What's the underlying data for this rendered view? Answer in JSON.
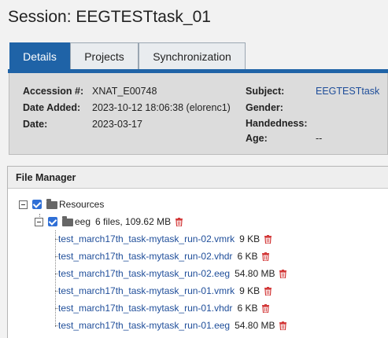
{
  "page": {
    "title": "Session: EEGTESTtask_01"
  },
  "tabs": [
    {
      "label": "Details"
    },
    {
      "label": "Projects"
    },
    {
      "label": "Synchronization"
    }
  ],
  "details": {
    "accession_label": "Accession #:",
    "accession_value": "XNAT_E00748",
    "date_added_label": "Date Added:",
    "date_added_value": "2023-10-12 18:06:38 (elorenc1)",
    "date_label": "Date:",
    "date_value": "2023-03-17",
    "subject_label": "Subject:",
    "subject_value": "EEGTESTtask",
    "gender_label": "Gender:",
    "handedness_label": "Handedness:",
    "age_label": "Age:",
    "age_value": "--"
  },
  "file_manager": {
    "title": "File Manager",
    "root": {
      "label": "Resources"
    },
    "folder": {
      "label": "eeg",
      "summary": "6 files, 109.62 MB"
    },
    "files": [
      {
        "name": "test_march17th_task-mytask_run-02.vmrk",
        "size": "9 KB"
      },
      {
        "name": "test_march17th_task-mytask_run-02.vhdr",
        "size": "6 KB"
      },
      {
        "name": "test_march17th_task-mytask_run-02.eeg",
        "size": "54.80 MB"
      },
      {
        "name": "test_march17th_task-mytask_run-01.vmrk",
        "size": "9 KB"
      },
      {
        "name": "test_march17th_task-mytask_run-01.vhdr",
        "size": "6 KB"
      },
      {
        "name": "test_march17th_task-mytask_run-01.eeg",
        "size": "54.80 MB"
      }
    ]
  },
  "colors": {
    "accent": "#1f63a7",
    "link": "#1f4e9a",
    "danger": "#d33a3a"
  }
}
